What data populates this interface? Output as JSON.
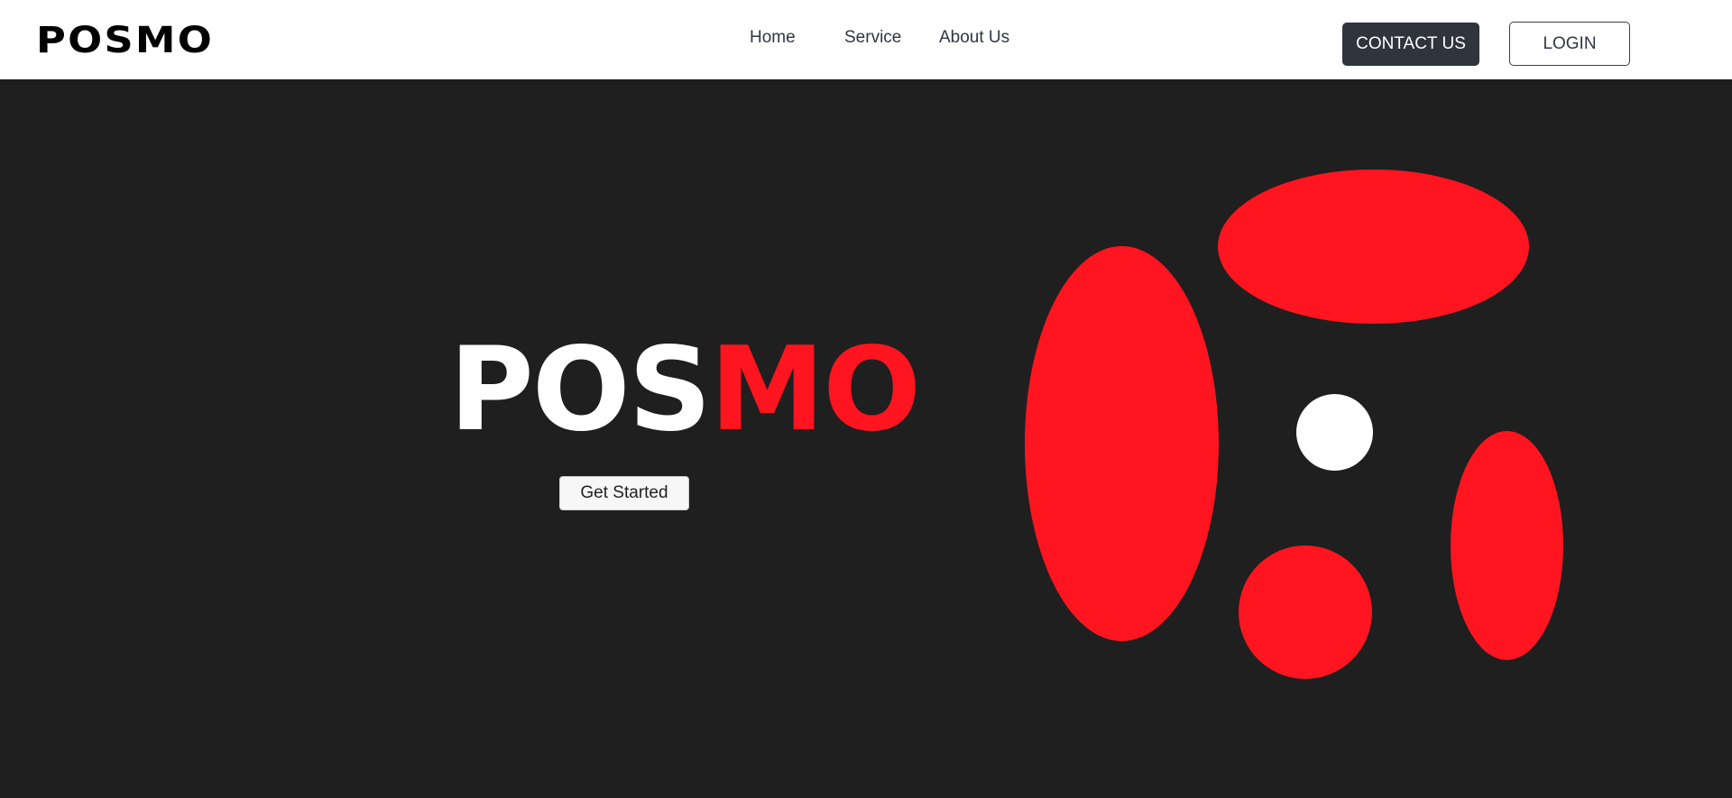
{
  "header": {
    "brand": "POSMO",
    "nav": [
      {
        "label": "Home"
      },
      {
        "label": "Service"
      },
      {
        "label": "About Us"
      }
    ],
    "contact_label": "CONTACT US",
    "login_label": "LOGIN"
  },
  "hero": {
    "title_part_1": "POS",
    "title_part_2": "MO",
    "cta_label": "Get Started"
  },
  "colors": {
    "accent_red": "#ff151f",
    "hero_background": "#1f1f1f",
    "dark_button": "#2f343d",
    "white": "#ffffff"
  }
}
